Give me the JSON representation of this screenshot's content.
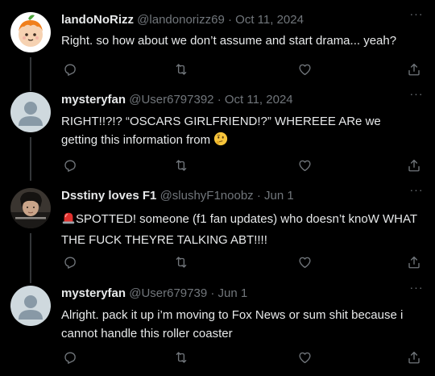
{
  "tweets": [
    {
      "name": "landoNoRizz",
      "handle": "@landonorizz69",
      "separator": "·",
      "date": "Oct 11, 2024",
      "text": "Right. so how about we don’t assume and start drama... yeah?",
      "more_label": "···",
      "avatar_icon": "orange-cartoon-avatar"
    },
    {
      "name": "mysteryfan",
      "handle": "@User6797392",
      "separator": "·",
      "date": "Oct 11, 2024",
      "text": "RIGHT!!?!? “OSCARS GIRLFRIEND!?” WHEREEE ARe we getting this information from",
      "emoji_icon": "thinking-face-icon",
      "more_label": "···",
      "avatar_icon": "default-profile-avatar"
    },
    {
      "name": "Dsstiny loves F1",
      "handle": "@slushyF1noobz",
      "separator": "·",
      "date": "Jun 1",
      "text": "SPOTTED! someone (f1 fan updates) who doesn’t knoW WHAT THE FUCK THEYRE TALKING ABT!!!!",
      "emoji_icon": "rotating-light-icon",
      "more_label": "···",
      "avatar_icon": "photo-avatar"
    },
    {
      "name": "mysteryfan",
      "handle": "@User679739",
      "separator": "·",
      "date": "Jun 1",
      "text": "Alright. pack it up i’m moving to Fox News or sum shit because i cannot handle this roller coaster",
      "more_label": "···",
      "avatar_icon": "default-profile-avatar"
    }
  ],
  "colors": {
    "background": "#000000",
    "text": "#e7e9ea",
    "muted": "#71767b",
    "thread_line": "#333639"
  }
}
